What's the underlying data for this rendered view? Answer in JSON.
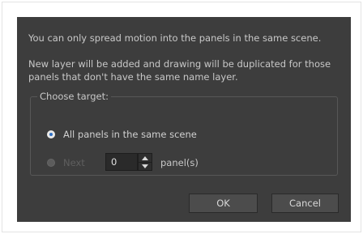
{
  "message_line1": "You can only spread motion into the panels in the same scene.",
  "message_line2": "New layer will be added and drawing will be duplicated for those panels that don't have the same name layer.",
  "target_group": {
    "title": "Choose target:",
    "option_all_label": "All panels in the same scene",
    "option_all_selected": true,
    "option_next_label": "Next",
    "option_next_selected": false,
    "next_count_value": "0",
    "next_unit_label": "panel(s)"
  },
  "buttons": {
    "ok_label": "OK",
    "cancel_label": "Cancel"
  },
  "colors": {
    "dialog_bg": "#3d3d3d",
    "radio_accent": "#2e6fc4"
  }
}
